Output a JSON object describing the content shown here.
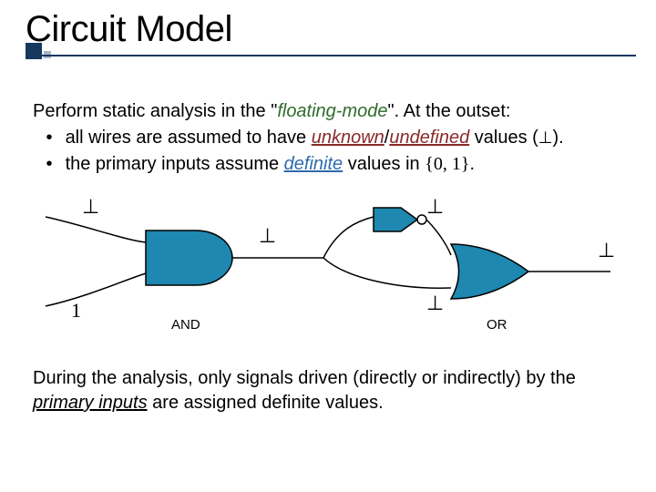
{
  "title": "Circuit Model",
  "intro": {
    "lead": "Perform static analysis in the \"",
    "floating_mode": "floating-mode",
    "lead_tail": "\". At the outset:"
  },
  "bullets": {
    "b1_a": "all wires are assumed to have ",
    "b1_unknown": "unknown",
    "b1_slash": "/",
    "b1_undefined": "undefined",
    "b1_b": " values (",
    "b1_bot": "⊥",
    "b1_c": ").",
    "b2_a": "the primary inputs assume ",
    "b2_definite": "definite",
    "b2_b": " values in ",
    "b2_set": "{0, 1}",
    "b2_c": "."
  },
  "diagram": {
    "labels": {
      "and": "AND",
      "or": "OR"
    },
    "signals": {
      "top_in": "⊥",
      "mid_after_and": "⊥",
      "top_to_or": "⊥",
      "bot_to_or": "⊥",
      "out": "⊥",
      "bot_in": "1"
    },
    "colors": {
      "gate_fill": "#1e88b0",
      "wire": "#000000"
    }
  },
  "closing": {
    "a": "During the analysis, only signals driven (directly or indirectly) by the ",
    "pinputs": "primary inputs",
    "b": " are assigned definite values."
  }
}
